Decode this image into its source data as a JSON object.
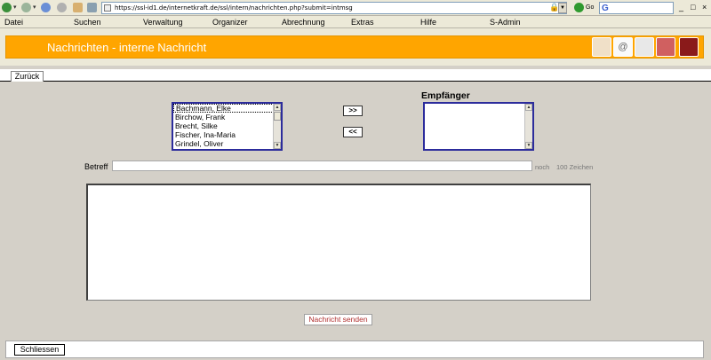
{
  "browser": {
    "url": "https://ssl-id1.de/internetkraft.de/ssl/intern/nachrichten.php?submit=intmsg",
    "go_label": "Go",
    "search_value": "",
    "minimize": "_",
    "maximize": "□",
    "close": "×"
  },
  "menu": {
    "items": [
      "Datei",
      "Suchen",
      "Verwaltung",
      "Organizer",
      "Abrechnung",
      "Extras",
      "Hilfe",
      "S-Admin"
    ]
  },
  "header": {
    "title": "Nachrichten - interne Nachricht",
    "accent_color": "#ffa500",
    "icons": [
      "address-book-icon",
      "mail-icon",
      "shield-icon",
      "logout-icon",
      "trash-icon"
    ]
  },
  "tab": {
    "back_label": "Zurück"
  },
  "recipients": {
    "available": [
      "Bachmann, Elke",
      "Birchow, Frank",
      "Brecht, Silke",
      "Fischer, Ina-Maria",
      "Grindel, Oliver"
    ],
    "selected_index": 0,
    "heading": "Empfänger",
    "chosen": [],
    "add_label": ">>",
    "remove_label": "<<"
  },
  "subject": {
    "label": "Betreff",
    "value": "",
    "counter_prefix": "noch",
    "counter_text": "100 Zeichen"
  },
  "message": {
    "value": ""
  },
  "actions": {
    "send_label": "Nachricht senden",
    "close_label": "Schliessen"
  }
}
